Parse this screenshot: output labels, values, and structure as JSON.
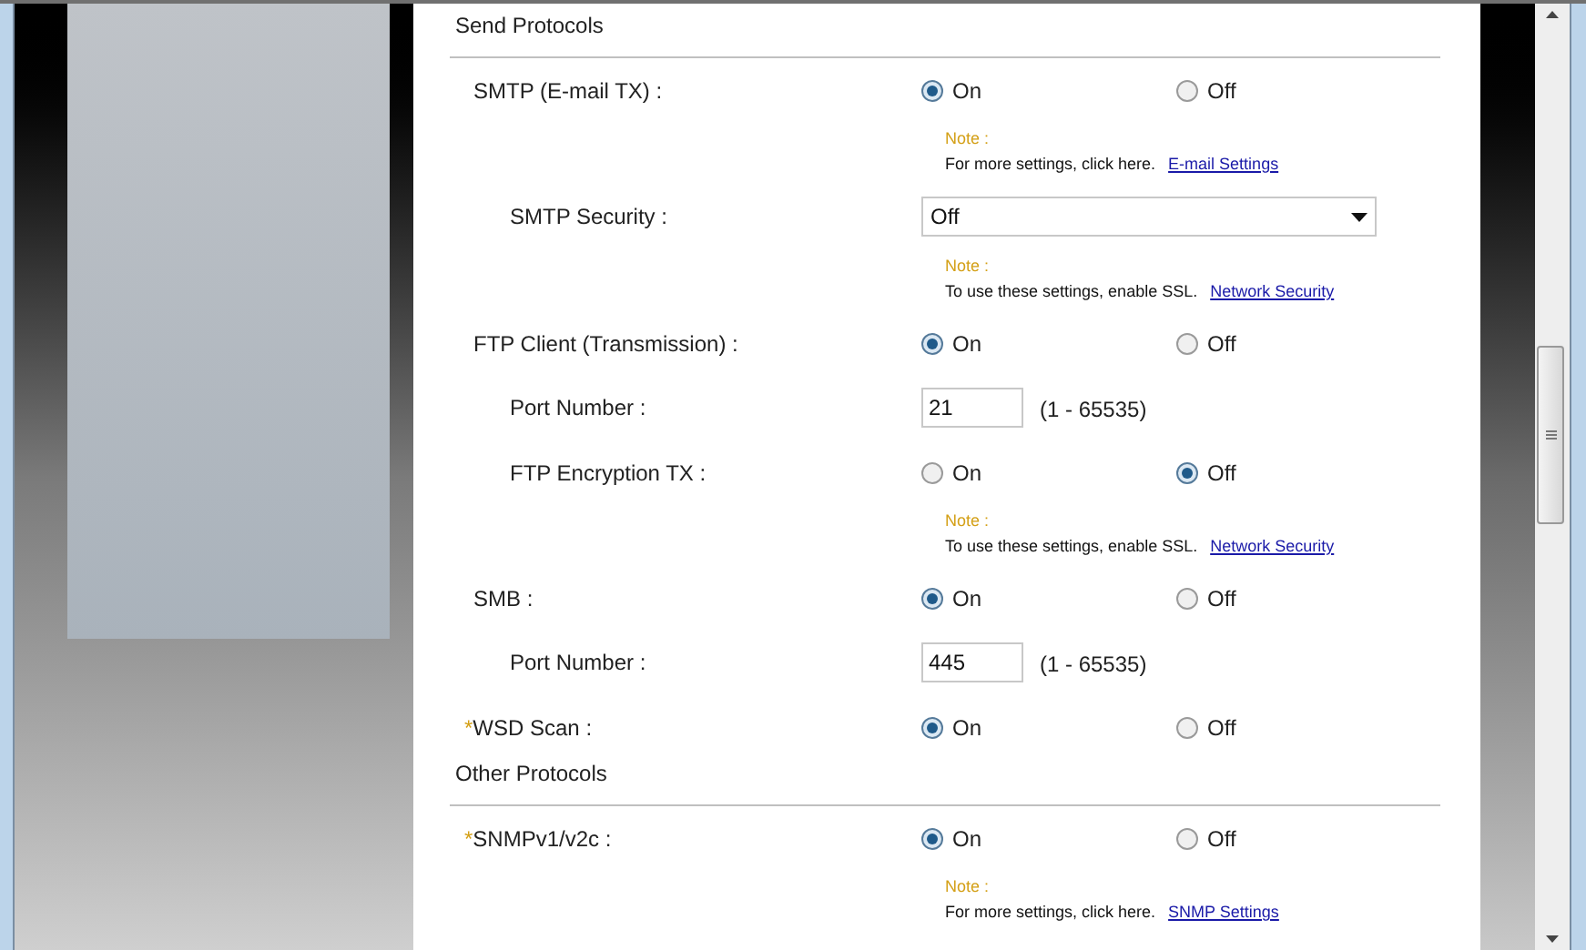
{
  "sections": [
    {
      "title": "Send Protocols",
      "rows": [
        {
          "kind": "radio",
          "label": "SMTP (E-mail TX) :",
          "options": [
            {
              "label": "On",
              "selected": true
            },
            {
              "label": "Off",
              "selected": false
            }
          ],
          "children": [
            {
              "kind": "note",
              "heading": "Note :",
              "text": "For more settings, click here.",
              "link": "E-mail Settings"
            },
            {
              "kind": "select",
              "label": "SMTP Security :",
              "value": "Off"
            },
            {
              "kind": "note",
              "heading": "Note :",
              "text": "To use these settings, enable SSL.",
              "link": "Network Security"
            }
          ]
        },
        {
          "kind": "radio",
          "label": "FTP Client (Transmission) :",
          "options": [
            {
              "label": "On",
              "selected": true
            },
            {
              "label": "Off",
              "selected": false
            }
          ],
          "children": [
            {
              "kind": "number",
              "label": "Port Number :",
              "value": "21",
              "range": "(1 - 65535)"
            },
            {
              "kind": "radio",
              "label": "FTP Encryption TX :",
              "options": [
                {
                  "label": "On",
                  "selected": false
                },
                {
                  "label": "Off",
                  "selected": true
                }
              ]
            },
            {
              "kind": "note",
              "heading": "Note :",
              "text": "To use these settings, enable SSL.",
              "link": "Network Security"
            }
          ]
        },
        {
          "kind": "radio",
          "label": "SMB :",
          "options": [
            {
              "label": "On",
              "selected": true
            },
            {
              "label": "Off",
              "selected": false
            }
          ],
          "children": [
            {
              "kind": "number",
              "label": "Port Number :",
              "value": "445",
              "range": "(1 - 65535)"
            }
          ]
        },
        {
          "kind": "radio",
          "marker": "*",
          "label": "WSD Scan :",
          "options": [
            {
              "label": "On",
              "selected": true
            },
            {
              "label": "Off",
              "selected": false
            }
          ]
        }
      ]
    },
    {
      "title": "Other Protocols",
      "rows": [
        {
          "kind": "radio",
          "marker": "*",
          "label": "SNMPv1/v2c :",
          "options": [
            {
              "label": "On",
              "selected": true
            },
            {
              "label": "Off",
              "selected": false
            }
          ],
          "children": [
            {
              "kind": "note",
              "heading": "Note :",
              "text": "For more settings, click here.",
              "link": "SNMP Settings"
            }
          ]
        }
      ]
    }
  ]
}
